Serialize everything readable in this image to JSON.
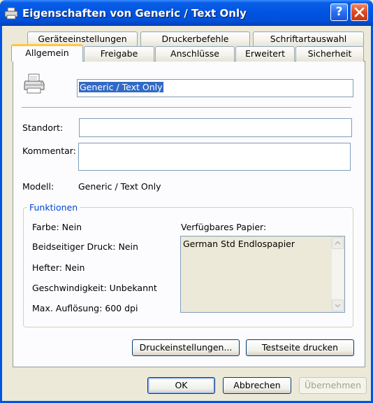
{
  "window": {
    "title": "Eigenschaften von Generic / Text Only"
  },
  "tabs_back": [
    "Geräteeinstellungen",
    "Druckerbefehle",
    "Schriftartauswahl"
  ],
  "tabs_front": [
    "Allgemein",
    "Freigabe",
    "Anschlüsse",
    "Erweitert",
    "Sicherheit"
  ],
  "general": {
    "printer_name": "Generic / Text Only",
    "location_label": "Standort:",
    "location_value": "",
    "comment_label": "Kommentar:",
    "comment_value": "",
    "model_label": "Modell:",
    "model_value": "Generic / Text Only"
  },
  "features": {
    "title": "Funktionen",
    "color": "Farbe: Nein",
    "duplex": "Beidseitiger Druck: Nein",
    "staple": "Hefter: Nein",
    "speed": "Geschwindigkeit: Unbekannt",
    "resolution": "Max. Auflösung: 600 dpi",
    "paper_label": "Verfügbares Papier:",
    "paper_items": [
      "German Std Endlospapier"
    ]
  },
  "buttons": {
    "preferences": "Druckeinstellungen...",
    "test_page": "Testseite drucken",
    "ok": "OK",
    "cancel": "Abbrechen",
    "apply": "Übernehmen"
  },
  "colors": {
    "title_bar": "#0054e3",
    "dialog_bg": "#ece9d8",
    "group_title": "#0046d5",
    "selection": "#316ac5"
  },
  "icons": {
    "title": "printer-icon",
    "printer": "printer-icon",
    "help": "help-icon",
    "close": "close-icon"
  }
}
